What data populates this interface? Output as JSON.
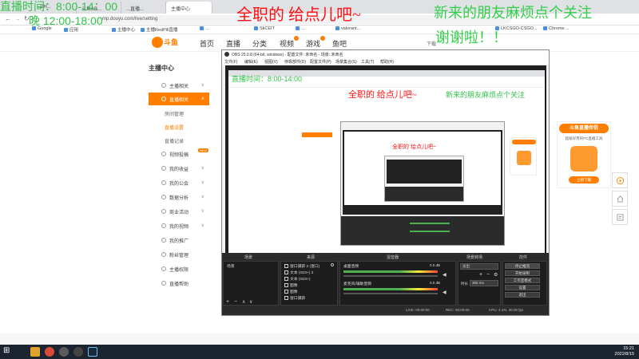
{
  "browser": {
    "tabs": [
      {
        "label": "...2H...",
        "active": false
      },
      {
        "label": "斗鱼AB...",
        "active": false
      },
      {
        "label": "...直播...",
        "active": false
      },
      {
        "label": "主播中心",
        "active": true
      }
    ],
    "url": "mp.douyu.com/live/setting",
    "bookmarks": [
      "Google",
      "应用",
      "主播中心",
      "主播RedPill直播",
      "...",
      "SkCEIT",
      "...",
      "valorant...",
      "LKCSGO-CSGO...",
      "Chrome ..."
    ]
  },
  "site": {
    "logo_text": "斗鱼",
    "nav": [
      "首页",
      "直播",
      "分类",
      "视频",
      "游戏",
      "鱼吧"
    ],
    "download_label": "下载"
  },
  "menu": {
    "title": "主播中心",
    "items": [
      {
        "label": "主播相关",
        "type": "item",
        "state": ""
      },
      {
        "label": "直播相关",
        "type": "item",
        "state": "active"
      },
      {
        "label": "房间管理",
        "type": "sub",
        "state": ""
      },
      {
        "label": "直播设置",
        "type": "sub",
        "state": "activesub"
      },
      {
        "label": "直播记录",
        "type": "sub",
        "state": ""
      },
      {
        "label": "视频投稿",
        "type": "item",
        "state": "",
        "badge": "NEW"
      },
      {
        "label": "我的收益",
        "type": "item",
        "state": ""
      },
      {
        "label": "我的公会",
        "type": "item",
        "state": ""
      },
      {
        "label": "数据分析",
        "type": "item",
        "state": ""
      },
      {
        "label": "商业活动",
        "type": "item",
        "state": ""
      },
      {
        "label": "我的视频",
        "type": "item",
        "state": ""
      },
      {
        "label": "我的推广",
        "type": "item",
        "state": ""
      },
      {
        "label": "粉丝管理",
        "type": "item",
        "state": ""
      },
      {
        "label": "主播权限",
        "type": "item",
        "state": ""
      },
      {
        "label": "直播帮助",
        "type": "item",
        "state": ""
      }
    ]
  },
  "obs": {
    "title": "OBS 25.0.8 (64-bit, windows) - 配置文件: 未命名 - 场景: 未命名",
    "menubar": [
      "文件(F)",
      "编辑(E)",
      "视图(V)",
      "停靠部件(D)",
      "配置文件(P)",
      "场景集合(S)",
      "工具(T)",
      "帮助(H)"
    ],
    "docks": {
      "scenes": "场景",
      "sources": "来源",
      "mixer": "混音器",
      "transitions": "场景转场",
      "controls": "控件"
    },
    "scenes": [
      "场景"
    ],
    "sources": [
      "窗口捕获 2 (窗口)",
      "文本 (GDI+) 2",
      "文本 (GDI+)",
      "图像",
      "图像",
      "窗口捕获"
    ],
    "mixer": [
      {
        "name": "桌面音频",
        "db": "0.0 dB"
      },
      {
        "name": "麦克风/辅助音频",
        "db": "0.0 dB"
      }
    ],
    "transition": {
      "mode": "淡出",
      "duration_label": "时长",
      "duration": "300 ms"
    },
    "controls": [
      "停止推流",
      "开始录制",
      "工作室模式",
      "设置",
      "退出"
    ],
    "status": {
      "live": "LIVE: 00:00:00",
      "rec": "REC: 00:00:00",
      "cpu": "CPU: 4.1%, 30.00 fps"
    }
  },
  "promo": {
    "title": "斗鱼直播伴侣",
    "subtitle": "超级好用的PC直播工具",
    "button": "立即下载"
  },
  "overlays": {
    "time_line1": "直播时间：8:00-14：00",
    "time_line2": "晚 12:00-18:00",
    "main": "全职的 给点儿吧~",
    "right1": "新来的朋友麻烦点个关注",
    "right2": "谢谢啦！！"
  },
  "nested_overlays": {
    "main": "全职的 给点儿吧~",
    "left": "直播时间：8:00-14:00",
    "right": "新来的朋友麻烦点个关注"
  },
  "taskbar": {
    "time": "15:21",
    "date": "2022/8/15"
  },
  "colors": {
    "brand": "#ff7e00",
    "overlay_green": "#33c24a",
    "overlay_red": "#ff1010",
    "obs_dark": "#2b2b2b"
  }
}
